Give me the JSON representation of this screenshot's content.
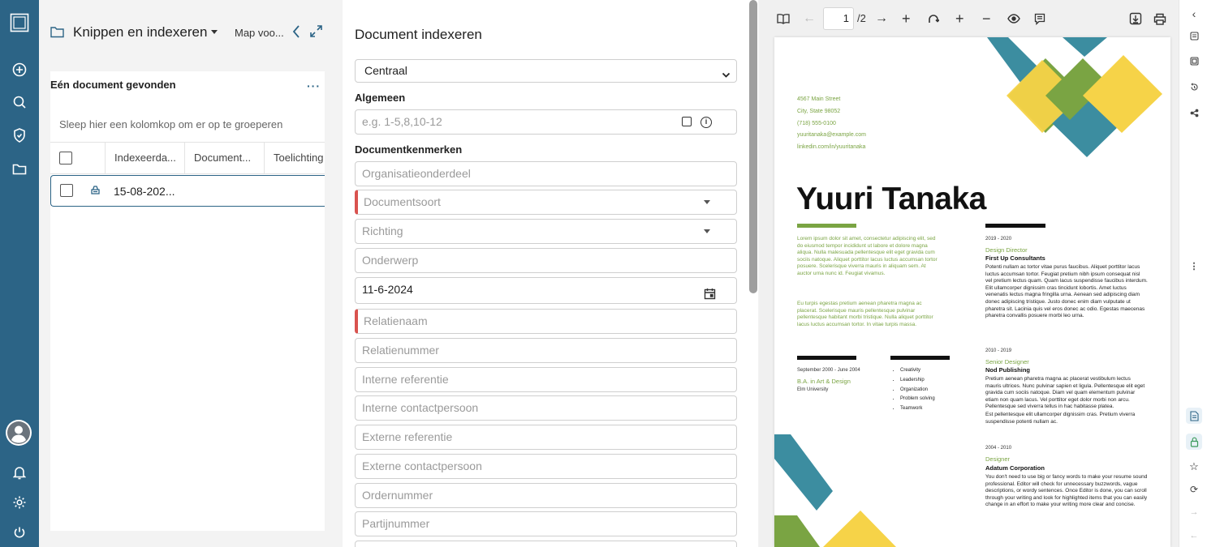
{
  "panel1": {
    "title": "Knippen en indexeren",
    "map_label": "Map voo...",
    "found": "Eén document gevonden",
    "group_hint": "Sleep hier een kolomkop om er op te groeperen",
    "columns": [
      "Indexeerda...",
      "Document...",
      "Toelichting"
    ],
    "row": {
      "date": "15-08-202..."
    }
  },
  "panel2": {
    "title": "Document indexeren",
    "select_value": "Centraal",
    "sec_general": "Algemeen",
    "general_placeholder": "e.g. 1-5,8,10-12",
    "sec_props": "Documentkenmerken",
    "fields": {
      "org": "Organisatieonderdeel",
      "doctype": "Documentsoort",
      "direction": "Richting",
      "subject": "Onderwerp",
      "date": "11-6-2024",
      "relname": "Relatienaam",
      "relnum": "Relatienummer",
      "intref": "Interne referentie",
      "intcontact": "Interne contactpersoon",
      "extref": "Externe referentie",
      "extcontact": "Externe contactpersoon",
      "order": "Ordernummer",
      "batch": "Partijnummer"
    }
  },
  "viewer": {
    "page": "1",
    "total": "/2",
    "resume": {
      "address": "4567 Main Street",
      "city": "City, State 98052",
      "phone": "(718) 555-0100",
      "email": "yuuritanaka@example.com",
      "linkedin": "linkedin.com/in/yuuritanaka",
      "name": "Yuuri Tanaka",
      "intro1": "Lorem ipsum dolor sit amet, consectetur adipiscing elit, sed do eiusmod tempor incididunt ut labore et dolore magna aliqua. Nulla malesuada pellentesque elit eget gravida cum sociis natoque. Aliquet porttitor lacus luctus accumsan tortor posuere. Scelerisque viverra mauris in aliquam sem. At auctor urna nunc id. Feugiat vivamus.",
      "intro2": "Eu turpis egestas pretium aenean pharetra magna ac placerat. Scelerisque mauris pellentesque pulvinar pellentesque habitant morbi tristique. Nulla aliquet porttitor lacus luctus accumsan tortor. In vitae turpis massa.",
      "edu_date": "September 2000 - June 2004",
      "edu_degree": "B.A. in Art & Design",
      "edu_school": "Elm University",
      "skills": [
        "Creativity",
        "Leadership",
        "Organization",
        "Problem solving",
        "Teamwork"
      ],
      "job1_date": "2019 - 2020",
      "job1_title": "Design Director",
      "job1_company": "First Up Consultants",
      "job1_text": "Potenti nullam ac tortor vitae purus faucibus. Aliquet porttitor lacus luctus accumsan tortor. Feugiat pretium nibh ipsum consequat nisl vel pretium lectus quam. Quam lacus suspendisse faucibus interdum. Elit ullamcorper dignissim cras tincidunt lobortis. Amet luctus venenatis lectus magna fringilla urna. Aenean sed adipiscing diam donec adipiscing tristique. Justo donec enim diam vulputate ut pharetra sit. Lacinia quis vel eros donec ac odio. Egestas maecenas pharetra convallis posuere morbi leo urna.",
      "job2_date": "2010 - 2019",
      "job2_title": "Senior Designer",
      "job2_company": "Nod Publishing",
      "job2_text": "Pretium aenean pharetra magna ac placerat vestibulum lectus mauris ultrices. Nunc pulvinar sapien et ligula. Pellentesque elit eget gravida cum sociis natoque. Diam vel quam elementum pulvinar etiam non quam lacus. Vel porttitor eget dolor morbi non arcu. Pellentesque sed viverra tellus in hac habitasse platea.",
      "job2_text2": "Est pellentesque elit ullamcorper dignissim cras. Pretium viverra suspendisse potenti nullam ac.",
      "job3_date": "2004 - 2010",
      "job3_title": "Designer",
      "job3_company": "Adatum Corporation",
      "job3_text": "You don't need to use big or fancy words to make your resume sound professional. Editor will check for unnecessary buzzwords, vague descriptions, or wordy sentences. Once Editor is done, you can scroll through your writing and look for highlighted items that you can easily change in an effort to make your writing more clear and concise."
    }
  },
  "colors": {
    "rail": "#2c6486",
    "required": "#d9534f",
    "teal": "#3c8da0",
    "green": "#7aa443",
    "yellow": "#f6d348"
  }
}
